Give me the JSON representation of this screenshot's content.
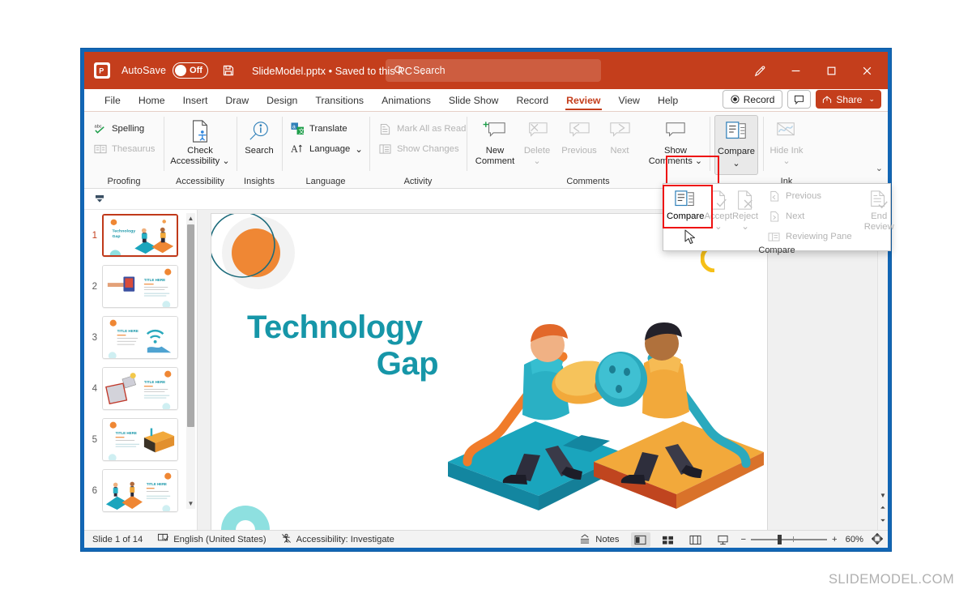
{
  "titlebar": {
    "app_icon": "powerpoint-icon",
    "autosave_label": "AutoSave",
    "autosave_state": "Off",
    "save_icon": "save-icon",
    "document_title": "SlideModel.pptx",
    "document_separator": "•",
    "document_location": "Saved to this PC",
    "search_placeholder": "Search",
    "pen_icon": "pen-icon",
    "minimize": "—",
    "maximize": "▢",
    "close": "✕"
  },
  "tabs": [
    {
      "label": "File",
      "active": false
    },
    {
      "label": "Home",
      "active": false
    },
    {
      "label": "Insert",
      "active": false
    },
    {
      "label": "Draw",
      "active": false
    },
    {
      "label": "Design",
      "active": false
    },
    {
      "label": "Transitions",
      "active": false
    },
    {
      "label": "Animations",
      "active": false
    },
    {
      "label": "Slide Show",
      "active": false
    },
    {
      "label": "Record",
      "active": false
    },
    {
      "label": "Review",
      "active": true
    },
    {
      "label": "View",
      "active": false
    },
    {
      "label": "Help",
      "active": false
    }
  ],
  "tabs_right": {
    "record_label": "Record",
    "comment_icon": "comment-icon",
    "share_label": "Share",
    "share_chevron": "⌄"
  },
  "ribbon": {
    "collapse_chevron": "⌄",
    "groups": [
      {
        "name": "Proofing",
        "label": "Proofing",
        "items": [
          {
            "label": "Spelling",
            "icon": "spelling-abc-check-icon",
            "disabled": false,
            "size": "small"
          },
          {
            "label": "Thesaurus",
            "icon": "thesaurus-book-icon",
            "disabled": true,
            "size": "small"
          }
        ]
      },
      {
        "name": "Accessibility",
        "label": "Accessibility",
        "items": [
          {
            "label": "Check Accessibility",
            "icon": "check-accessibility-icon",
            "disabled": false,
            "size": "big",
            "chevron": "⌄"
          }
        ]
      },
      {
        "name": "Insights",
        "label": "Insights",
        "items": [
          {
            "label": "Search",
            "icon": "search-magnifier-icon",
            "disabled": false,
            "size": "big"
          }
        ]
      },
      {
        "name": "Language",
        "label": "Language",
        "items": [
          {
            "label": "Translate",
            "icon": "translate-icon",
            "disabled": false,
            "size": "small"
          },
          {
            "label": "Language",
            "icon": "language-icon",
            "disabled": false,
            "size": "small",
            "chevron": "⌄"
          }
        ]
      },
      {
        "name": "Activity",
        "label": "Activity",
        "items": [
          {
            "label": "Mark All as Read",
            "icon": "mark-all-read-icon",
            "disabled": true,
            "size": "small"
          },
          {
            "label": "Show Changes",
            "icon": "show-changes-icon",
            "disabled": true,
            "size": "small"
          }
        ]
      },
      {
        "name": "Comments",
        "label": "Comments",
        "items": [
          {
            "label": "New Comment",
            "icon": "new-comment-icon",
            "disabled": false,
            "size": "big"
          },
          {
            "label": "Delete",
            "icon": "delete-comment-icon",
            "disabled": true,
            "size": "big",
            "chevron": "⌄"
          },
          {
            "label": "Previous",
            "icon": "previous-comment-icon",
            "disabled": true,
            "size": "big"
          },
          {
            "label": "Next",
            "icon": "next-comment-icon",
            "disabled": true,
            "size": "big"
          },
          {
            "label": "Show Comments",
            "icon": "show-comments-icon",
            "disabled": false,
            "size": "big",
            "chevron": "⌄"
          }
        ]
      },
      {
        "name": "Compare",
        "label": "",
        "items": [
          {
            "label": "Compare",
            "icon": "compare-icon",
            "disabled": false,
            "size": "big",
            "chevron": "⌄",
            "selected": true,
            "highlighted": true
          }
        ]
      },
      {
        "name": "Ink",
        "label": "Ink",
        "items": [
          {
            "label": "Hide Ink",
            "icon": "hide-ink-icon",
            "disabled": true,
            "size": "big",
            "chevron": "⌄"
          }
        ]
      }
    ]
  },
  "compare_panel": {
    "group_label": "Compare",
    "items": [
      {
        "label": "Compare",
        "icon": "compare-icon",
        "disabled": false,
        "size": "big",
        "highlighted": true
      },
      {
        "label": "Accept",
        "icon": "accept-icon",
        "disabled": true,
        "size": "big",
        "chevron": "⌄"
      },
      {
        "label": "Reject",
        "icon": "reject-icon",
        "disabled": true,
        "size": "big",
        "chevron": "⌄"
      },
      {
        "label": "Previous",
        "icon": "previous-change-icon",
        "disabled": true,
        "size": "small"
      },
      {
        "label": "Next",
        "icon": "next-change-icon",
        "disabled": true,
        "size": "small"
      },
      {
        "label": "Reviewing Pane",
        "icon": "reviewing-pane-icon",
        "disabled": true,
        "size": "small"
      },
      {
        "label": "End Review",
        "icon": "end-review-icon",
        "disabled": true,
        "size": "big"
      }
    ]
  },
  "thumbnails": {
    "slides": [
      {
        "number": "1",
        "title": "Technology Gap",
        "active": true
      },
      {
        "number": "2",
        "title": "TITLE HERE",
        "active": false
      },
      {
        "number": "3",
        "title": "TITLE HERE",
        "active": false
      },
      {
        "number": "4",
        "title": "TITLE HERE",
        "active": false
      },
      {
        "number": "5",
        "title": "TITLE HERE",
        "active": false
      },
      {
        "number": "6",
        "title": "TITLE HERE",
        "active": false
      }
    ],
    "scroll_up": "▲",
    "scroll_down": "▼"
  },
  "slide": {
    "title_line1": "Technology",
    "title_line2": "Gap",
    "title_color": "#1696a8",
    "accent_orange": "#ef8734",
    "accent_teal": "#2aa9bd",
    "accent_mint": "#8ee0e0",
    "accent_yellow": "#f6c018",
    "accent_red": "#e8332a"
  },
  "canvas_scroll": {
    "prev_slide": "▲",
    "next_slide": "▼",
    "double_arrow_up": "⏶",
    "double_arrow_down": "⏷"
  },
  "statusbar": {
    "slide_counter": "Slide 1 of 14",
    "spellcheck_icon": "spellcheck-icon",
    "language": "English (United States)",
    "accessibility_icon": "accessibility-icon",
    "accessibility_status": "Accessibility: Investigate",
    "notes_label": "Notes",
    "views": [
      {
        "name": "normal-view",
        "icon": "normal-view-icon",
        "active": true
      },
      {
        "name": "slide-sorter-view",
        "icon": "slide-sorter-icon",
        "active": false
      },
      {
        "name": "reading-view",
        "icon": "reading-view-icon",
        "active": false
      },
      {
        "name": "slideshow-view",
        "icon": "slideshow-icon",
        "active": false
      }
    ],
    "zoom_out": "−",
    "zoom_in": "+",
    "zoom_level": "60%",
    "fit_icon": "fit-to-window-icon"
  },
  "watermark": "SLIDEMODEL.COM"
}
